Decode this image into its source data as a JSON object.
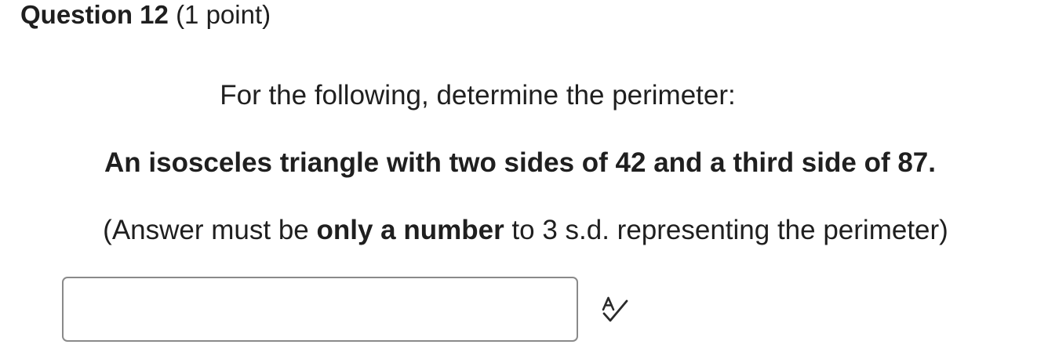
{
  "question": {
    "number_label": "Question 12",
    "points_label": "(1 point)"
  },
  "prompt": {
    "line1": "For the following, determine the perimeter:",
    "line2": "An isosceles triangle with two sides of 42 and a third side of 87.",
    "line3_pre": "(Answer must be ",
    "line3_bold": "only a number",
    "line3_post": " to 3 s.d. representing the perimeter)"
  },
  "answer": {
    "value": "",
    "placeholder": ""
  },
  "icons": {
    "spellcheck": "spellcheck-icon"
  }
}
